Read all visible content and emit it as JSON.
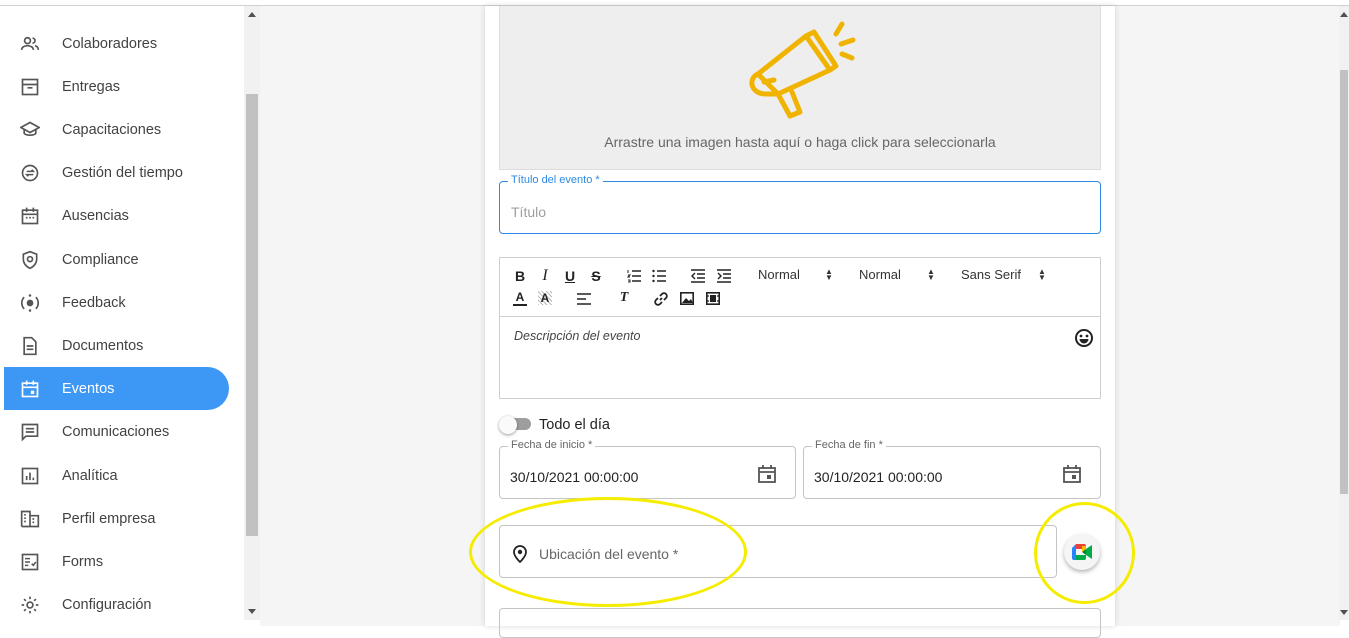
{
  "sidebar": {
    "items": [
      {
        "label": "Colaboradores",
        "icon": "people-icon"
      },
      {
        "label": "Entregas",
        "icon": "archive-icon"
      },
      {
        "label": "Capacitaciones",
        "icon": "school-icon"
      },
      {
        "label": "Gestión del tiempo",
        "icon": "time-exchange-icon"
      },
      {
        "label": "Ausencias",
        "icon": "calendar-icon"
      },
      {
        "label": "Compliance",
        "icon": "shield-icon"
      },
      {
        "label": "Feedback",
        "icon": "feedback-icon"
      },
      {
        "label": "Documentos",
        "icon": "document-icon"
      },
      {
        "label": "Eventos",
        "icon": "event-icon"
      },
      {
        "label": "Comunicaciones",
        "icon": "chat-icon"
      },
      {
        "label": "Analítica",
        "icon": "analytics-icon"
      },
      {
        "label": "Perfil empresa",
        "icon": "building-icon"
      },
      {
        "label": "Forms",
        "icon": "form-icon"
      },
      {
        "label": "Configuración",
        "icon": "gear-icon"
      }
    ],
    "active_index": 8
  },
  "upload": {
    "text": "Arrastre una imagen hasta aquí o haga click para seleccionarla",
    "icon": "megaphone-icon"
  },
  "title_field": {
    "label": "Título del evento *",
    "placeholder": "Título"
  },
  "editor": {
    "toolbar": {
      "bold": "B",
      "italic": "I",
      "underline": "U",
      "strike": "S",
      "color": "A",
      "background": "A",
      "clean": "T",
      "header_select": "Normal",
      "size_select": "Normal",
      "font_select": "Sans Serif"
    },
    "placeholder": "Descripción del evento"
  },
  "all_day": {
    "label": "Todo el día",
    "checked": false
  },
  "start_date": {
    "label": "Fecha de inicio *",
    "value": "30/10/2021 00:00:00"
  },
  "end_date": {
    "label": "Fecha de fin *",
    "value": "30/10/2021 00:00:00"
  },
  "location": {
    "placeholder": "Ubicación del evento *"
  },
  "meet_button": {
    "icon": "google-meet-icon"
  },
  "colors": {
    "accent": "#3d98f5",
    "focus": "#2d8ae0",
    "highlight": "#f5ec00",
    "megaphone": "#f0b400"
  }
}
